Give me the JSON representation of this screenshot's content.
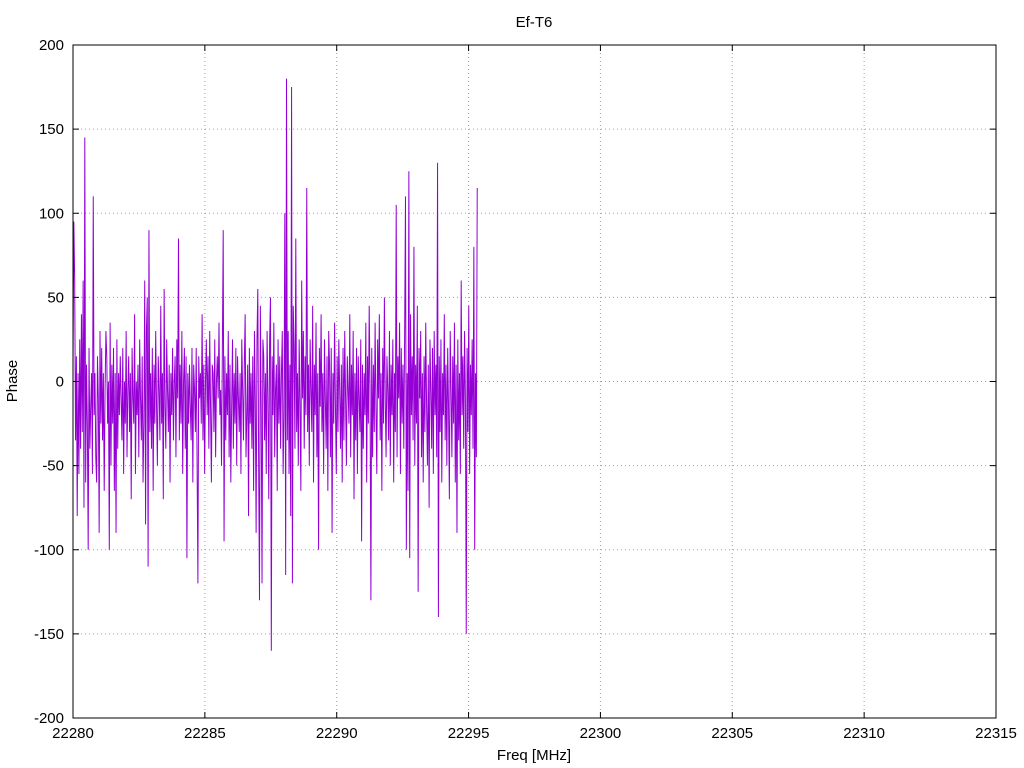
{
  "chart_data": {
    "type": "line",
    "title": "Ef-T6",
    "xlabel": "Freq [MHz]",
    "ylabel": "Phase",
    "xlim": [
      22280,
      22315
    ],
    "ylim": [
      -200,
      200
    ],
    "xticks": [
      22280,
      22285,
      22290,
      22295,
      22300,
      22305,
      22310,
      22315
    ],
    "yticks": [
      -200,
      -150,
      -100,
      -50,
      0,
      50,
      100,
      150,
      200
    ],
    "grid": true,
    "series_color": "#9400d3",
    "series": [
      {
        "x_start": 22280.0,
        "x_step": 0.032,
        "values": [
          10,
          95,
          60,
          -35,
          15,
          -80,
          5,
          -55,
          25,
          -40,
          40,
          -30,
          60,
          -75,
          145,
          -60,
          10,
          -25,
          -100,
          20,
          -40,
          -15,
          5,
          -55,
          110,
          -20,
          5,
          -45,
          -60,
          15,
          -10,
          -90,
          30,
          -25,
          20,
          -35,
          5,
          -65,
          -5,
          30,
          15,
          -25,
          0,
          -100,
          35,
          -50,
          10,
          -25,
          20,
          -65,
          5,
          -90,
          25,
          -40,
          5,
          -20,
          15,
          -10,
          -35,
          20,
          -55,
          0,
          -25,
          30,
          -45,
          -5,
          15,
          -30,
          5,
          -70,
          20,
          -10,
          -25,
          40,
          -55,
          0,
          -20,
          10,
          -45,
          25,
          -10,
          -35,
          15,
          -60,
          -25,
          60,
          -85,
          30,
          50,
          -110,
          90,
          -30,
          5,
          -40,
          20,
          -65,
          10,
          -25,
          30,
          -15,
          -50,
          15,
          -5,
          -35,
          45,
          -25,
          5,
          -70,
          55,
          -15,
          -40,
          25,
          -5,
          -30,
          10,
          -60,
          5,
          -20,
          20,
          -35,
          0,
          15,
          -45,
          25,
          -10,
          85,
          -35,
          10,
          -25,
          30,
          -55,
          0,
          20,
          -40,
          15,
          -105,
          5,
          -25,
          10,
          -15,
          -35,
          20,
          -60,
          10,
          -5,
          -30,
          20,
          -45,
          -120,
          15,
          -10,
          5,
          -25,
          40,
          -35,
          10,
          -55,
          0,
          25,
          -20,
          15,
          -40,
          30,
          -15,
          -60,
          10,
          5,
          -30,
          25,
          -45,
          0,
          15,
          -10,
          35,
          -20,
          -5,
          -50,
          20,
          90,
          -95,
          15,
          -35,
          5,
          -20,
          30,
          -45,
          10,
          -60,
          -15,
          25,
          -40,
          5,
          -25,
          20,
          -50,
          15,
          -10,
          -30,
          5,
          -55,
          25,
          -5,
          -35,
          10,
          40,
          -45,
          -20,
          10,
          -80,
          20,
          -25,
          5,
          -40,
          15,
          -65,
          30,
          -10,
          -90,
          25,
          55,
          -50,
          -130,
          45,
          -15,
          -120,
          25,
          15,
          -35,
          5,
          -55,
          30,
          -10,
          -70,
          25,
          50,
          -160,
          15,
          -20,
          35,
          -45,
          -5,
          10,
          -65,
          25,
          -25,
          15,
          -40,
          5,
          30,
          -55,
          -20,
          100,
          -115,
          180,
          -35,
          30,
          -55,
          10,
          -80,
          175,
          -120,
          45,
          20,
          -40,
          85,
          -30,
          5,
          -50,
          25,
          -15,
          -65,
          60,
          -10,
          30,
          -40,
          15,
          -20,
          115,
          -30,
          10,
          -50,
          25,
          -5,
          -30,
          45,
          -60,
          10,
          -20,
          35,
          -45,
          5,
          -100,
          20,
          -15,
          40,
          -30,
          5,
          -55,
          25,
          -10,
          -40,
          15,
          -65,
          30,
          10,
          -45,
          20,
          -90,
          5,
          -25,
          35,
          -15,
          -55,
          15,
          -30,
          25,
          -5,
          -40,
          10,
          -60,
          20,
          -35,
          30,
          -10,
          -50,
          15,
          -5,
          -25,
          40,
          -45,
          10,
          -20,
          30,
          -70,
          5,
          -35,
          20,
          -55,
          15,
          -10,
          -30,
          25,
          -95,
          10,
          -40,
          5,
          -20,
          35,
          -60,
          15,
          -25,
          45,
          -5,
          -130,
          20,
          -45,
          10,
          -30,
          35,
          -15,
          -55,
          25,
          -10,
          40,
          -35,
          5,
          -65,
          20,
          -25,
          50,
          -10,
          -45,
          15,
          -5,
          -35,
          30,
          -50,
          10,
          -20,
          25,
          -60,
          5,
          -30,
          105,
          -45,
          15,
          -10,
          35,
          -55,
          20,
          -25,
          10,
          -40,
          30,
          110,
          -100,
          5,
          -65,
          125,
          -105,
          40,
          -20,
          15,
          -35,
          80,
          -50,
          10,
          -25,
          45,
          -125,
          20,
          -10,
          30,
          -45,
          5,
          -60,
          15,
          -30,
          35,
          -15,
          -50,
          10,
          -75,
          25,
          -5,
          -40,
          20,
          -55,
          30,
          -20,
          10,
          -45,
          130,
          -140,
          15,
          -30,
          25,
          -60,
          5,
          -20,
          40,
          -35,
          10,
          -50,
          20,
          -15,
          -70,
          30,
          -5,
          -45,
          15,
          -25,
          35,
          -60,
          10,
          -90,
          25,
          -35,
          5,
          -55,
          60,
          -20,
          15,
          -40,
          30,
          -10,
          -150,
          20,
          -30,
          45,
          -55,
          10,
          -20,
          25,
          -40,
          80,
          -100,
          5,
          -45,
          115
        ]
      }
    ]
  }
}
